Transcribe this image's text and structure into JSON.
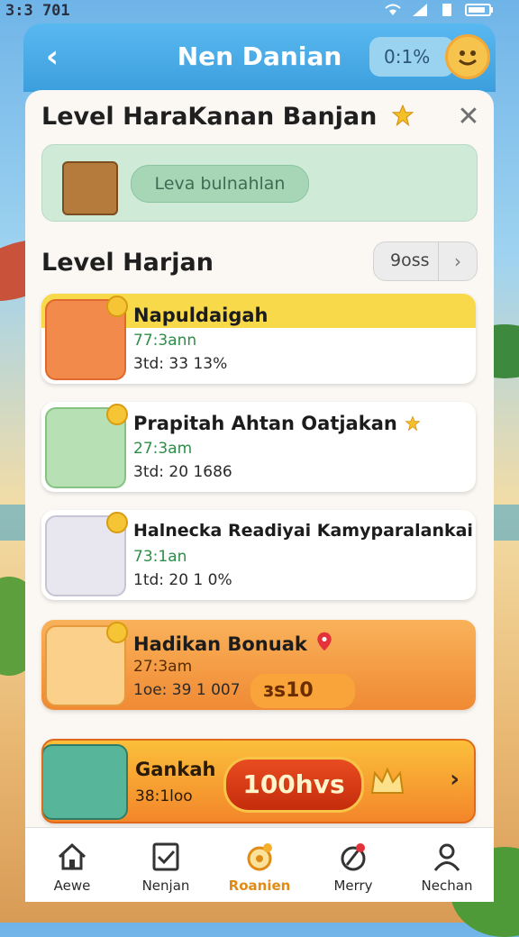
{
  "status_bar": {
    "time": "3:3 701"
  },
  "app_bar": {
    "title": "Nen Danian",
    "pill_value": "0:1%"
  },
  "header": {
    "title": "Level HaraKanan Banjan"
  },
  "banner": {
    "button_label": "Leva bulnahlan"
  },
  "list_section": {
    "title": "Level Harjan",
    "filter_label": "9oss"
  },
  "items": [
    {
      "name": "Napuldaigah",
      "subtitle": "77:3ann",
      "stat": "3td: 33 13%"
    },
    {
      "name": "Prapitah Ahtan Oatjakan",
      "subtitle": "27:3am",
      "stat": "3td: 20 1686"
    },
    {
      "name": "Halnecka Readiyai Kamyparalankai",
      "subtitle": "73:1an",
      "stat": "1td: 20 1 0%"
    },
    {
      "name": "Hadikan Bonuak",
      "subtitle": "27:3am",
      "stat": "1oe: 39 1 007",
      "price": "ɜs10"
    }
  ],
  "promo": {
    "name": "Gankah",
    "subtitle": "38:1loo",
    "button_label": "100hvs"
  },
  "nav": [
    {
      "label": "Aewe",
      "icon": "home-icon"
    },
    {
      "label": "Nenjan",
      "icon": "task-icon"
    },
    {
      "label": "Roanien",
      "icon": "reward-icon",
      "active": true
    },
    {
      "label": "Merry",
      "icon": "pin-icon"
    },
    {
      "label": "Nechan",
      "icon": "profile-icon"
    }
  ],
  "colors": {
    "accent": "#3c9fdd",
    "highlight": "#f7d94a",
    "orange": "#f59a3e",
    "green_text": "#2c8e47",
    "active_tab": "#e08b16"
  }
}
